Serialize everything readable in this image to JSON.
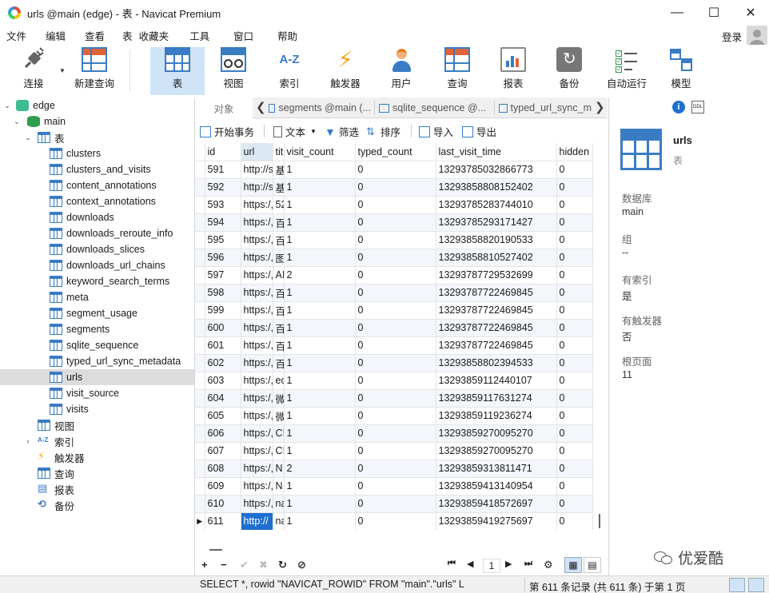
{
  "window": {
    "title": "urls @main (edge) - 表 - Navicat Premium",
    "minimize": "—",
    "maximize": "☐",
    "close": "✕"
  },
  "menu": [
    "文件",
    "编辑",
    "查看",
    "表",
    "收藏夹",
    "工具",
    "窗口",
    "帮助"
  ],
  "account": {
    "login": "登录"
  },
  "toolbar": {
    "connect": "连接",
    "new_query": "新建查询",
    "table": "表",
    "view": "视图",
    "index": "索引",
    "trigger": "触发器",
    "user": "用户",
    "query": "查询",
    "report": "报表",
    "backup": "备份",
    "automation": "自动运行",
    "model": "模型"
  },
  "tree": {
    "connection": "edge",
    "database": "main",
    "tables_group": "表",
    "tables": [
      "clusters",
      "clusters_and_visits",
      "content_annotations",
      "context_annotations",
      "downloads",
      "downloads_reroute_info",
      "downloads_slices",
      "downloads_url_chains",
      "keyword_search_terms",
      "meta",
      "segment_usage",
      "segments",
      "sqlite_sequence",
      "typed_url_sync_metadata",
      "urls",
      "visit_source",
      "visits"
    ],
    "selected_table": "urls",
    "other_groups": [
      "视图",
      "索引",
      "触发器",
      "查询",
      "报表",
      "备份"
    ]
  },
  "tabs": {
    "objects": "对象",
    "items": [
      "segments @main (...",
      "sqlite_sequence @...",
      "typed_url_sync_m"
    ]
  },
  "data_toolbar": {
    "begin_transaction": "开始事务",
    "text": "文本",
    "filter": "筛选",
    "sort": "排序",
    "import": "导入",
    "export": "导出"
  },
  "grid": {
    "columns": [
      "id",
      "url",
      "tit",
      "visit_count",
      "typed_count",
      "last_visit_time",
      "hidden"
    ],
    "rows": [
      [
        "591",
        "http://s",
        "基",
        "1",
        "0",
        "13293785032866773",
        "0"
      ],
      [
        "592",
        "http://s",
        "基",
        "1",
        "0",
        "13293858808152402",
        "0"
      ],
      [
        "593",
        "https:/,",
        "52",
        "1",
        "0",
        "13293785283744010",
        "0"
      ],
      [
        "594",
        "https:/,",
        "百",
        "1",
        "0",
        "13293785293171427",
        "0"
      ],
      [
        "595",
        "https:/,",
        "百",
        "1",
        "0",
        "13293858820190533",
        "0"
      ],
      [
        "596",
        "https:/,",
        "图",
        "1",
        "0",
        "13293858810527402",
        "0"
      ],
      [
        "597",
        "https:/,",
        "AI",
        "2",
        "0",
        "13293787729532699",
        "0"
      ],
      [
        "598",
        "https:/,",
        "百",
        "1",
        "0",
        "13293787722469845",
        "0"
      ],
      [
        "599",
        "https:/,",
        "百",
        "1",
        "0",
        "13293787722469845",
        "0"
      ],
      [
        "600",
        "https:/,",
        "百",
        "1",
        "0",
        "13293787722469845",
        "0"
      ],
      [
        "601",
        "https:/,",
        "百",
        "1",
        "0",
        "13293787722469845",
        "0"
      ],
      [
        "602",
        "https:/,",
        "百",
        "1",
        "0",
        "13293858802394533",
        "0"
      ],
      [
        "603",
        "https:/,",
        "ec",
        "1",
        "0",
        "13293859112440107",
        "0"
      ],
      [
        "604",
        "https:/,",
        "微",
        "1",
        "0",
        "13293859117631274",
        "0"
      ],
      [
        "605",
        "https:/,",
        "微",
        "1",
        "0",
        "13293859119236274",
        "0"
      ],
      [
        "606",
        "https:/,",
        "C!",
        "1",
        "0",
        "13293859270095270",
        "0"
      ],
      [
        "607",
        "https:/,",
        "C!",
        "1",
        "0",
        "13293859270095270",
        "0"
      ],
      [
        "608",
        "https:/,",
        "N",
        "2",
        "0",
        "13293859313811471",
        "0"
      ],
      [
        "609",
        "https:/,",
        "N",
        "1",
        "0",
        "13293859413140954",
        "0"
      ],
      [
        "610",
        "https:/,",
        "na",
        "1",
        "0",
        "13293859418572697",
        "0"
      ],
      [
        "611",
        "http://",
        "na",
        "1",
        "0",
        "13293859419275697",
        "0"
      ]
    ],
    "current_row_marker": "▶"
  },
  "bottom_nav": {
    "add": "+",
    "delete": "−",
    "apply": "✔",
    "discard": "✖",
    "refresh": "↻",
    "stop": "⊘",
    "first": "⏮",
    "prev": "◀",
    "page": "1",
    "next": "▶",
    "last": "⏭",
    "settings": "⚙"
  },
  "info_panel": {
    "table_name": "urls",
    "object_type": "表",
    "fields": [
      {
        "key": "数据库",
        "value": "main"
      },
      {
        "key": "组",
        "value": "--"
      },
      {
        "key": "有索引",
        "value": "是"
      },
      {
        "key": "有触发器",
        "value": "否"
      },
      {
        "key": "根页面",
        "value": "11"
      }
    ],
    "ddl_label": "DDL",
    "info_label": "i"
  },
  "watermark": "优爱酷",
  "status": {
    "sql": "SELECT *, rowid \"NAVICAT_ROWID\" FROM \"main\".\"urls\" L",
    "record_info": "第 611 条记录 (共 611 条) 于第 1 页"
  },
  "colors": {
    "accent": "#3a7cc4",
    "selection": "#1e6fd0",
    "active_tool": "#cfe4f7"
  }
}
